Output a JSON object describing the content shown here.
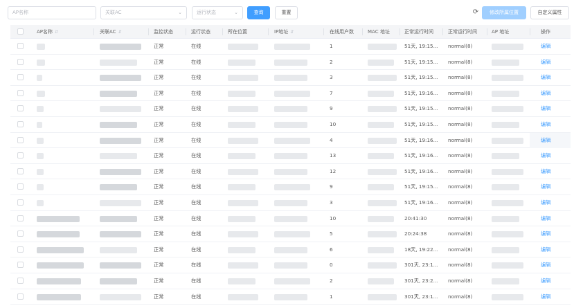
{
  "toolbar": {
    "ap_name_placeholder": "AP名称",
    "ac_placeholder": "关联AC",
    "status_placeholder": "运行状态",
    "search_label": "查询",
    "reset_label": "重置",
    "edit_location_label": "修改所属位置",
    "custom_attr_label": "自定义属性"
  },
  "columns": {
    "ap_name": "AP名称",
    "ac": "关联AC",
    "monitor": "监控状态",
    "run": "运行状态",
    "location": "所在位置",
    "ip": "IP地址",
    "users": "在线用户数",
    "mac": "MAC 地址",
    "uptime": "正常运行时间",
    "normal_time": "正常运行时间",
    "ap_addr": "AP 地址",
    "op": "操作"
  },
  "rows": [
    {
      "monitor": "正常",
      "run": "在线",
      "users": "1",
      "uptime": "51天, 19:15...",
      "mode": "normal(8)",
      "op": "编辑"
    },
    {
      "monitor": "正常",
      "run": "在线",
      "users": "2",
      "uptime": "51天, 19:15...",
      "mode": "normal(8)",
      "op": "编辑"
    },
    {
      "monitor": "正常",
      "run": "在线",
      "users": "3",
      "uptime": "51天, 19:15...",
      "mode": "normal(8)",
      "op": "编辑"
    },
    {
      "monitor": "正常",
      "run": "在线",
      "users": "7",
      "uptime": "51天, 19:16...",
      "mode": "normal(8)",
      "op": "编辑"
    },
    {
      "monitor": "正常",
      "run": "在线",
      "users": "9",
      "uptime": "51天, 19:15...",
      "mode": "normal(8)",
      "op": "编辑"
    },
    {
      "monitor": "正常",
      "run": "在线",
      "users": "10",
      "uptime": "51天, 19:15...",
      "mode": "normal(8)",
      "op": "编辑"
    },
    {
      "monitor": "正常",
      "run": "在线",
      "users": "4",
      "uptime": "51天, 19:16...",
      "mode": "normal(8)",
      "op": "编辑"
    },
    {
      "monitor": "正常",
      "run": "在线",
      "users": "13",
      "uptime": "51天, 19:16...",
      "mode": "normal(8)",
      "op": "编辑"
    },
    {
      "monitor": "正常",
      "run": "在线",
      "users": "12",
      "uptime": "51天, 19:16...",
      "mode": "normal(8)",
      "op": "编辑"
    },
    {
      "monitor": "正常",
      "run": "在线",
      "users": "9",
      "uptime": "51天, 19:15...",
      "mode": "normal(8)",
      "op": "编辑"
    },
    {
      "monitor": "正常",
      "run": "在线",
      "users": "3",
      "uptime": "51天, 19:16...",
      "mode": "normal(8)",
      "op": "编辑"
    },
    {
      "monitor": "正常",
      "run": "在线",
      "users": "10",
      "uptime": "20:41:30",
      "mode": "normal(8)",
      "op": "编辑"
    },
    {
      "monitor": "正常",
      "run": "在线",
      "users": "5",
      "uptime": "20:24:38",
      "mode": "normal(8)",
      "op": "编辑"
    },
    {
      "monitor": "正常",
      "run": "在线",
      "users": "6",
      "uptime": "18天, 19:22...",
      "mode": "normal(8)",
      "op": "编辑"
    },
    {
      "monitor": "正常",
      "run": "在线",
      "users": "0",
      "uptime": "301天, 23:1...",
      "mode": "normal(8)",
      "op": "编辑"
    },
    {
      "monitor": "正常",
      "run": "在线",
      "users": "2",
      "uptime": "301天, 23:2...",
      "mode": "normal(8)",
      "op": "编辑"
    },
    {
      "monitor": "正常",
      "run": "在线",
      "users": "1",
      "uptime": "301天, 23:1...",
      "mode": "normal(8)",
      "op": "编辑"
    }
  ],
  "colors": {
    "primary": "#409eff",
    "primary_disabled": "#a0cfff",
    "header_bg": "#f4f5f7"
  }
}
